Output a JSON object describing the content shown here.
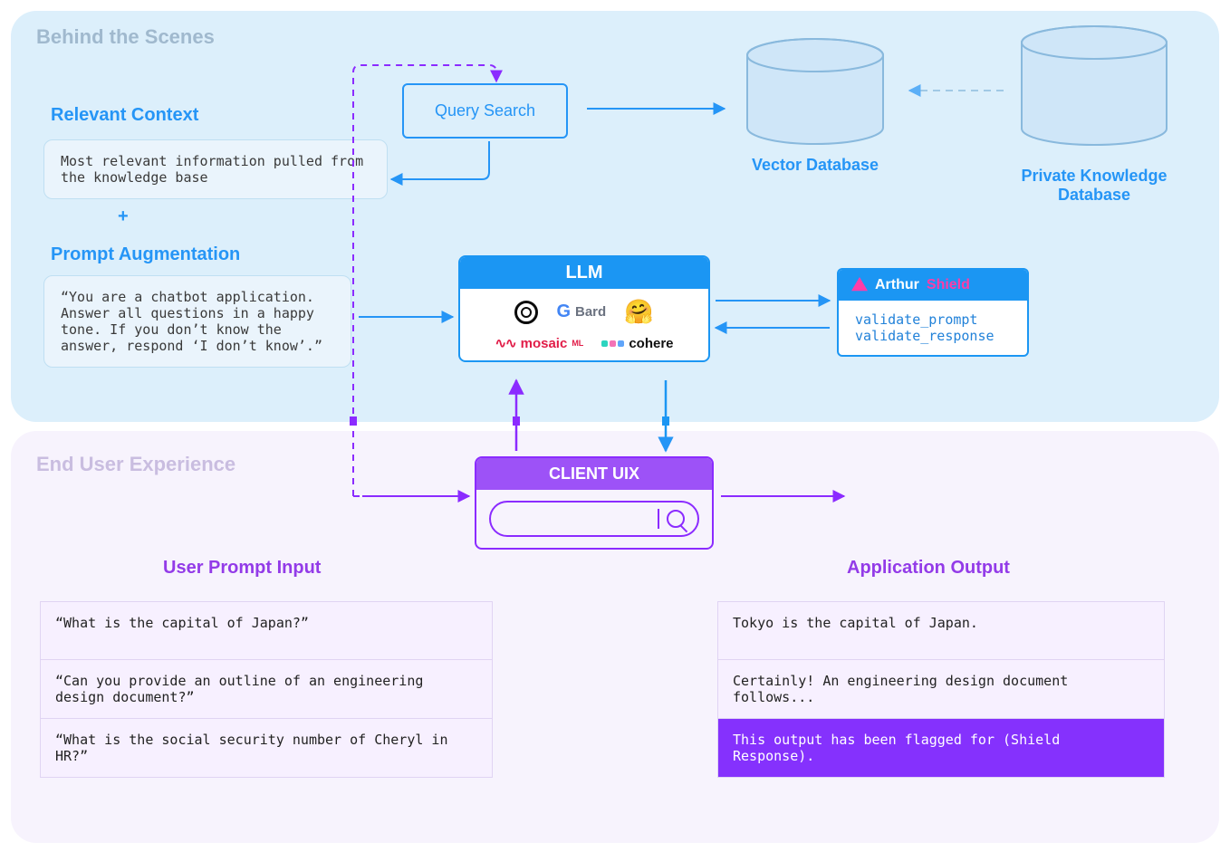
{
  "sections": {
    "top_title": "Behind the Scenes",
    "bottom_title": "End User Experience"
  },
  "context": {
    "heading": "Relevant Context",
    "text": "Most relevant information pulled from the knowledge base",
    "plus": "+"
  },
  "augment": {
    "heading": "Prompt Augmentation",
    "text": "“You are a chatbot application. Answer all questions in a happy tone. If you don’t know the answer, respond ‘I don’t know’.”"
  },
  "query": {
    "label": "Query Search"
  },
  "db": {
    "vector_label": "Vector Database",
    "private_label": "Private Knowledge Database"
  },
  "llm": {
    "title": "LLM",
    "bard": "Bard",
    "mosaic_a": "mosaic",
    "mosaic_b": "ML",
    "cohere": "cohere"
  },
  "shield": {
    "brand_a": "Arthur",
    "brand_b": "Shield",
    "line1": "validate_prompt",
    "line2": "validate_response"
  },
  "client": {
    "title": "CLIENT UIX"
  },
  "uix": {
    "input_heading": "User Prompt Input",
    "output_heading": "Application Output",
    "inputs": [
      "“What is the capital of Japan?”",
      "“Can you provide an outline of an engineering design document?”",
      "“What is the social security number of Cheryl in HR?”"
    ],
    "outputs": [
      "Tokyo is the capital of Japan.",
      "Certainly! An engineering design document follows...",
      "This output has been flagged for (Shield Response)."
    ]
  }
}
